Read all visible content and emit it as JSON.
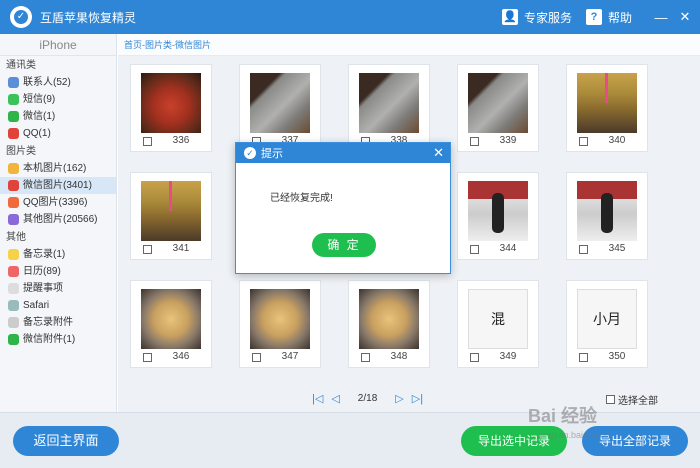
{
  "app": {
    "title": "互盾苹果恢复精灵"
  },
  "header": {
    "expert_label": "专家服务",
    "help_label": "帮助",
    "minimize": "—",
    "close": "✕"
  },
  "sidebar": {
    "device": "iPhone",
    "groups": [
      {
        "title": "通讯类",
        "items": [
          {
            "label": "联系人(52)",
            "color": "#5a8fd8"
          },
          {
            "label": "短信(9)",
            "color": "#3cc25a"
          },
          {
            "label": "微信(1)",
            "color": "#2fb44a"
          },
          {
            "label": "QQ(1)",
            "color": "#e0433a"
          }
        ]
      },
      {
        "title": "图片类",
        "items": [
          {
            "label": "本机图片(162)",
            "color": "#f0b53a"
          },
          {
            "label": "微信图片(3401)",
            "color": "#e0433a",
            "active": true
          },
          {
            "label": "QQ图片(3396)",
            "color": "#f06a3a"
          },
          {
            "label": "其他图片(20566)",
            "color": "#8a6ad8"
          }
        ]
      },
      {
        "title": "其他",
        "items": [
          {
            "label": "备忘录(1)",
            "color": "#f5d24a"
          },
          {
            "label": "日历(89)",
            "color": "#e66"
          },
          {
            "label": "提醒事项",
            "color": "#ddd"
          },
          {
            "label": "Safari",
            "color": "#9bb"
          },
          {
            "label": "备忘录附件",
            "color": "#ccc"
          },
          {
            "label": "微信附件(1)",
            "color": "#2fb44a"
          }
        ]
      }
    ]
  },
  "breadcrumb": "首页-图片类-微信图片",
  "photos": [
    {
      "num": "336",
      "kind": "food"
    },
    {
      "num": "337",
      "kind": "cloth"
    },
    {
      "num": "338",
      "kind": "cloth"
    },
    {
      "num": "339",
      "kind": "cloth"
    },
    {
      "num": "340",
      "kind": "drink"
    },
    {
      "num": "341",
      "kind": "drink"
    },
    {
      "num": "344",
      "kind": "person"
    },
    {
      "num": "345",
      "kind": "person"
    },
    {
      "num": "346",
      "kind": "dumpling"
    },
    {
      "num": "347",
      "kind": "dumpling"
    },
    {
      "num": "348",
      "kind": "dumpling"
    },
    {
      "num": "349",
      "kind": "screenshot",
      "text": "混"
    },
    {
      "num": "350",
      "kind": "screenshot",
      "text": "小月"
    }
  ],
  "pager": {
    "first": "|◁",
    "prev": "◁",
    "page": "2/18",
    "next": "▷",
    "last": "▷|"
  },
  "select_all_label": "选择全部",
  "footer": {
    "back_label": "返回主界面",
    "export_selected_label": "导出选中记录",
    "export_all_label": "导出全部记录"
  },
  "dialog": {
    "title": "提示",
    "message": "已经恢复完成!",
    "ok_label": "确 定",
    "close": "✕"
  },
  "watermark": {
    "brand": "Bai 经验",
    "url": "jingyan.baidu.com"
  }
}
